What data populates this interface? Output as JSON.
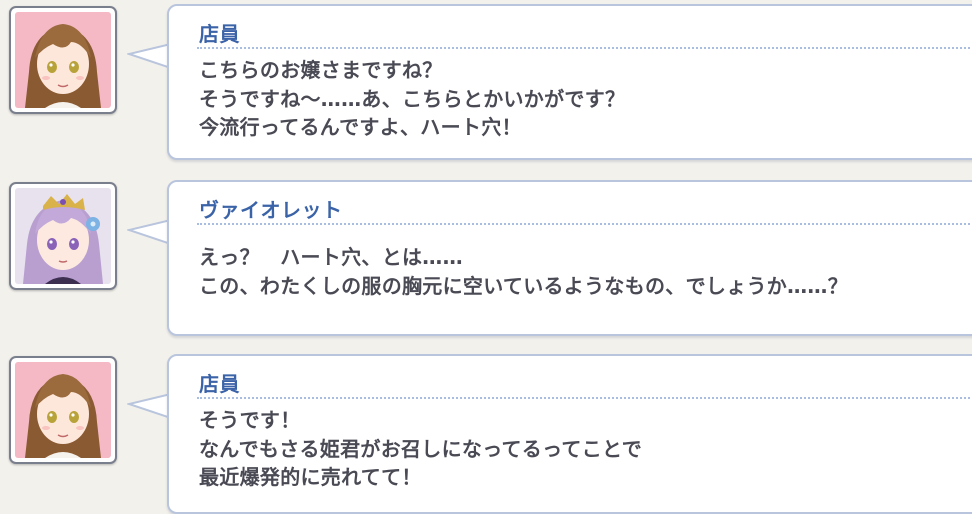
{
  "log": [
    {
      "speaker": "店員",
      "lines": [
        "こちらのお嬢さまですね？",
        "そうですね〜……あ、こちらとかいかがです？",
        "今流行ってるんですよ、ハート穴！"
      ]
    },
    {
      "speaker": "ヴァイオレット",
      "lines": [
        "えっ？　ハート穴、とは……",
        "この、わたくしの服の胸元に空いているようなもの、でしょうか……？"
      ]
    },
    {
      "speaker": "店員",
      "lines": [
        "そうです！",
        "なんでもさる姫君がお召しになってるってことで",
        "最近爆発的に売れてて！"
      ]
    }
  ],
  "colors": {
    "speaker_name": "#3b63a8",
    "dialogue_text": "#4a4a55",
    "bubble_border": "#b9c5dd",
    "background": "#f3f1ec"
  },
  "icons": {
    "portrait_1": "clerk-portrait",
    "portrait_2": "violet-portrait",
    "portrait_3": "clerk-portrait"
  }
}
